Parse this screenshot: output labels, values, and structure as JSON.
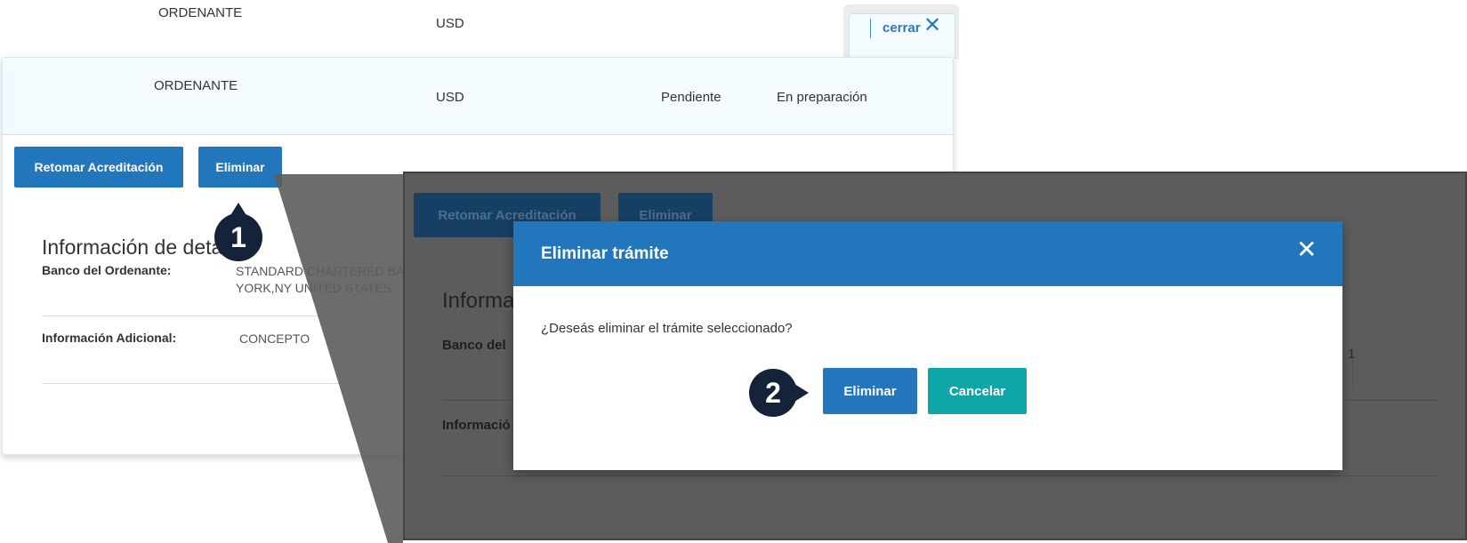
{
  "top_row": {
    "ordenante": "ORDENANTE",
    "currency": "USD",
    "close_label": "cerrar",
    "close_icon": "close-icon"
  },
  "card": {
    "header": {
      "ordenante": "ORDENANTE",
      "currency": "USD",
      "status": "Pendiente",
      "state": "En preparación"
    },
    "buttons": {
      "retomar": "Retomar Acreditación",
      "eliminar": "Eliminar"
    },
    "section_title": "Información de detalle",
    "fields": [
      {
        "label": "Banco del Ordenante:",
        "value": "STANDARD CHARTERED BANK NEW YORK,NY UNITED STATES"
      },
      {
        "label": "Información Adicional:",
        "value": "CONCEPTO"
      }
    ]
  },
  "zoom": {
    "buttons": {
      "retomar": "Retomar Acreditación",
      "eliminar": "Eliminar"
    },
    "section_title": "Informa",
    "label_banco": "Banco del",
    "label_info": "Informació",
    "right_fragment": "1"
  },
  "modal": {
    "title": "Eliminar trámite",
    "message": "¿Deseás eliminar el trámite seleccionado?",
    "confirm_label": "Eliminar",
    "cancel_label": "Cancelar",
    "close_icon": "close-icon"
  },
  "steps": [
    "1",
    "2"
  ],
  "colors": {
    "primary": "#2276bc",
    "teal": "#0fa6a8",
    "step_marker": "#14223a",
    "overlay": "#5c5c5c"
  }
}
